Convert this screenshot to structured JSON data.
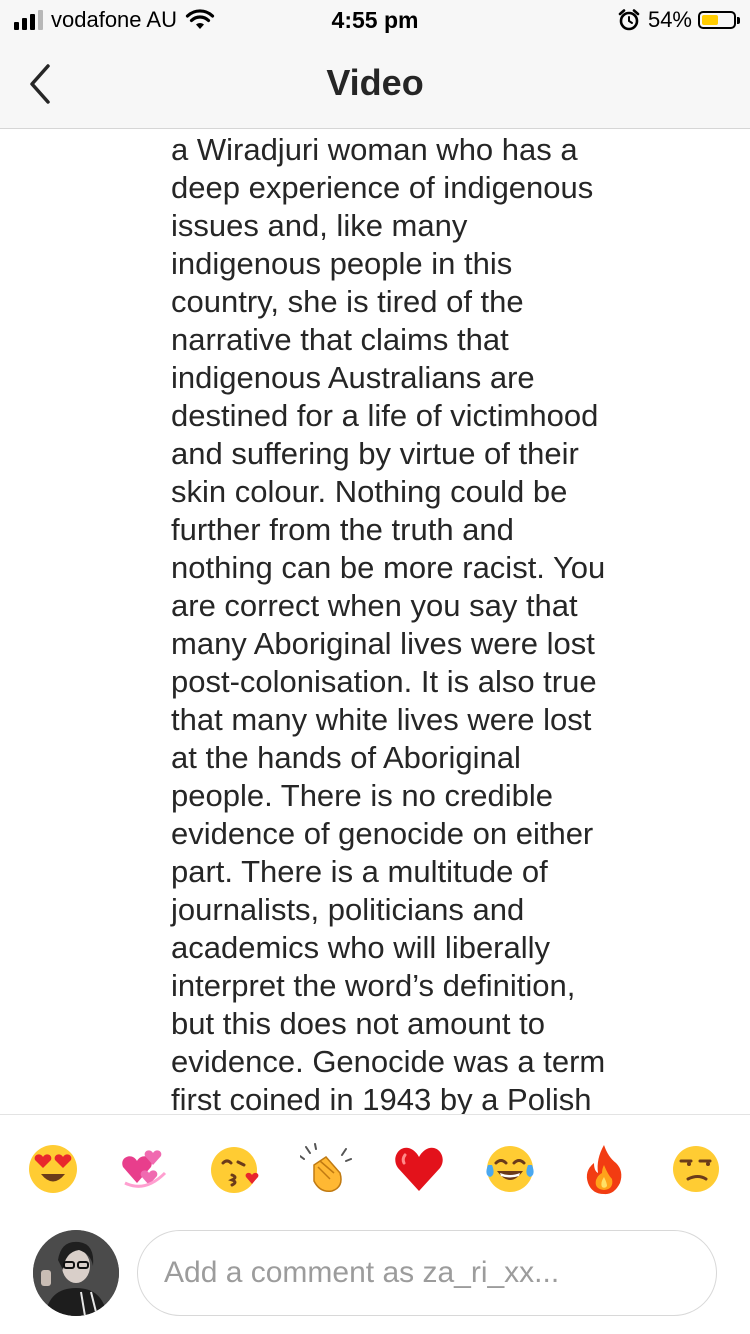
{
  "status_bar": {
    "carrier": "vodafone AU",
    "time": "4:55 pm",
    "battery_percent": "54%",
    "battery_level": 0.54,
    "signal_bars": 3,
    "icons": [
      "signal-icon",
      "wifi-icon",
      "alarm-icon",
      "battery-icon"
    ]
  },
  "nav": {
    "title": "Video",
    "back_icon": "chevron-left-icon"
  },
  "caption": {
    "lines": [
      "a Wiradjuri woman who has a",
      "deep experience of indigenous",
      "issues and, like many",
      "indigenous people in this",
      "country, she is tired of the",
      "narrative that claims that",
      "indigenous Australians are",
      "destined for a life of victimhood",
      "and suffering by virtue of their",
      "skin colour. Nothing could be",
      "further from the truth and",
      "nothing can be more racist. You",
      "are correct when you say that",
      "many Aboriginal lives were lost",
      "post-colonisation. It is also true",
      "that many white lives were lost",
      "at the hands of Aboriginal",
      "people. There is no credible",
      "evidence of genocide on either",
      "part. There is a multitude of",
      "journalists, politicians and",
      "academics who will liberally",
      "interpret the word’s definition,",
      "but this does not amount to",
      "evidence. Genocide was a term",
      "first coined in 1943 by a Polish"
    ]
  },
  "emoji_bar": {
    "emojis": [
      "heart-eyes-emoji",
      "revolving-hearts-emoji",
      "kissing-heart-emoji",
      "clapping-hands-emoji",
      "red-heart-emoji",
      "tears-of-joy-emoji",
      "fire-emoji",
      "unamused-emoji"
    ]
  },
  "comment": {
    "placeholder": "Add a comment as za_ri_xx...",
    "avatar_icon": "user-avatar"
  },
  "colors": {
    "bar_background": "#f7f7f7",
    "text": "#262626",
    "placeholder": "#9c9c9c",
    "battery": "#ffcc00"
  }
}
